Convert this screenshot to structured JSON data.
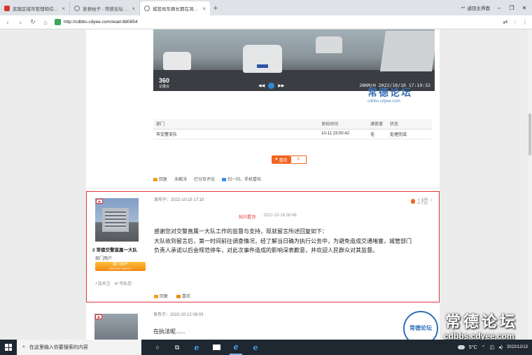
{
  "browser": {
    "tabs": [
      {
        "title": "武陵区城市管理和综合...",
        "active": false,
        "icon": "red-favicon"
      },
      {
        "title": "发表帖子 - 常德论坛 - ...",
        "active": false,
        "icon": "globe-icon"
      },
      {
        "title": "城管局车辆长期在洞庭...",
        "active": true,
        "icon": "globe-icon"
      }
    ],
    "new_tab": "+",
    "return_label": "返回主界面",
    "url": "http://cdbbs.cdyee.com/read-880854"
  },
  "video": {
    "logo": "360",
    "logo_sub": "记录仪",
    "timestamp": "28KM/H  2022/10/10  17:19:32"
  },
  "watermark_small": {
    "title": "常德论坛",
    "domain": "cdbbs.cdyee.com"
  },
  "reply_table": {
    "headers": [
      "部门",
      "",
      "发帖时间",
      "满意度",
      "状态"
    ],
    "row": [
      "市交警支队",
      "",
      "10-11 23:00:42",
      "无",
      "处理完成"
    ]
  },
  "like": {
    "label": "喜欢",
    "count": "0"
  },
  "post_actions": [
    "回复",
    "未解决",
    "打分及评论",
    "扫一扫，手机看帖"
  ],
  "floor": {
    "time": "发布于：2022-10-15 17:10",
    "number": "1楼",
    "edit_note": "帖内置顶 ·",
    "edit_time": "· 2022-10-16 08:46",
    "author": "常德交警直属一大队",
    "author_prefix": "2",
    "role": "部门用户",
    "badge": "部门用户",
    "badge_sub": "DEPARTMENT",
    "follow": "+加关注",
    "message": "写私信",
    "body": [
      "感谢您对交警直属一大队工作的监督与支持，现就留言所述回复如下：",
      "大队收到留言后，第一时间前往调查情况，经了解当日确为执行公务中，为避免造成交通堵塞，城管部门",
      "负责人承诺以后会规范停车，对此次事件造成的影响深表歉意，并欢迎人民群众对其监督。"
    ],
    "actions": [
      "回复",
      "喜欢"
    ]
  },
  "next_post": {
    "time": "发布于：2022-10-12 08:03",
    "body": "在执法呢......"
  },
  "watermark_big": {
    "seal": "常德论坛",
    "title": "常德论坛",
    "domain": "cdbbs.cdyee.com"
  },
  "taskbar": {
    "search_placeholder": "在这里输入你要搜索的内容",
    "temperature": "5°C",
    "date": "2022/12/13"
  },
  "colors": {
    "accent": "#f26522",
    "highlight_border": "#e0393e",
    "taskbar": "#1f2731"
  }
}
